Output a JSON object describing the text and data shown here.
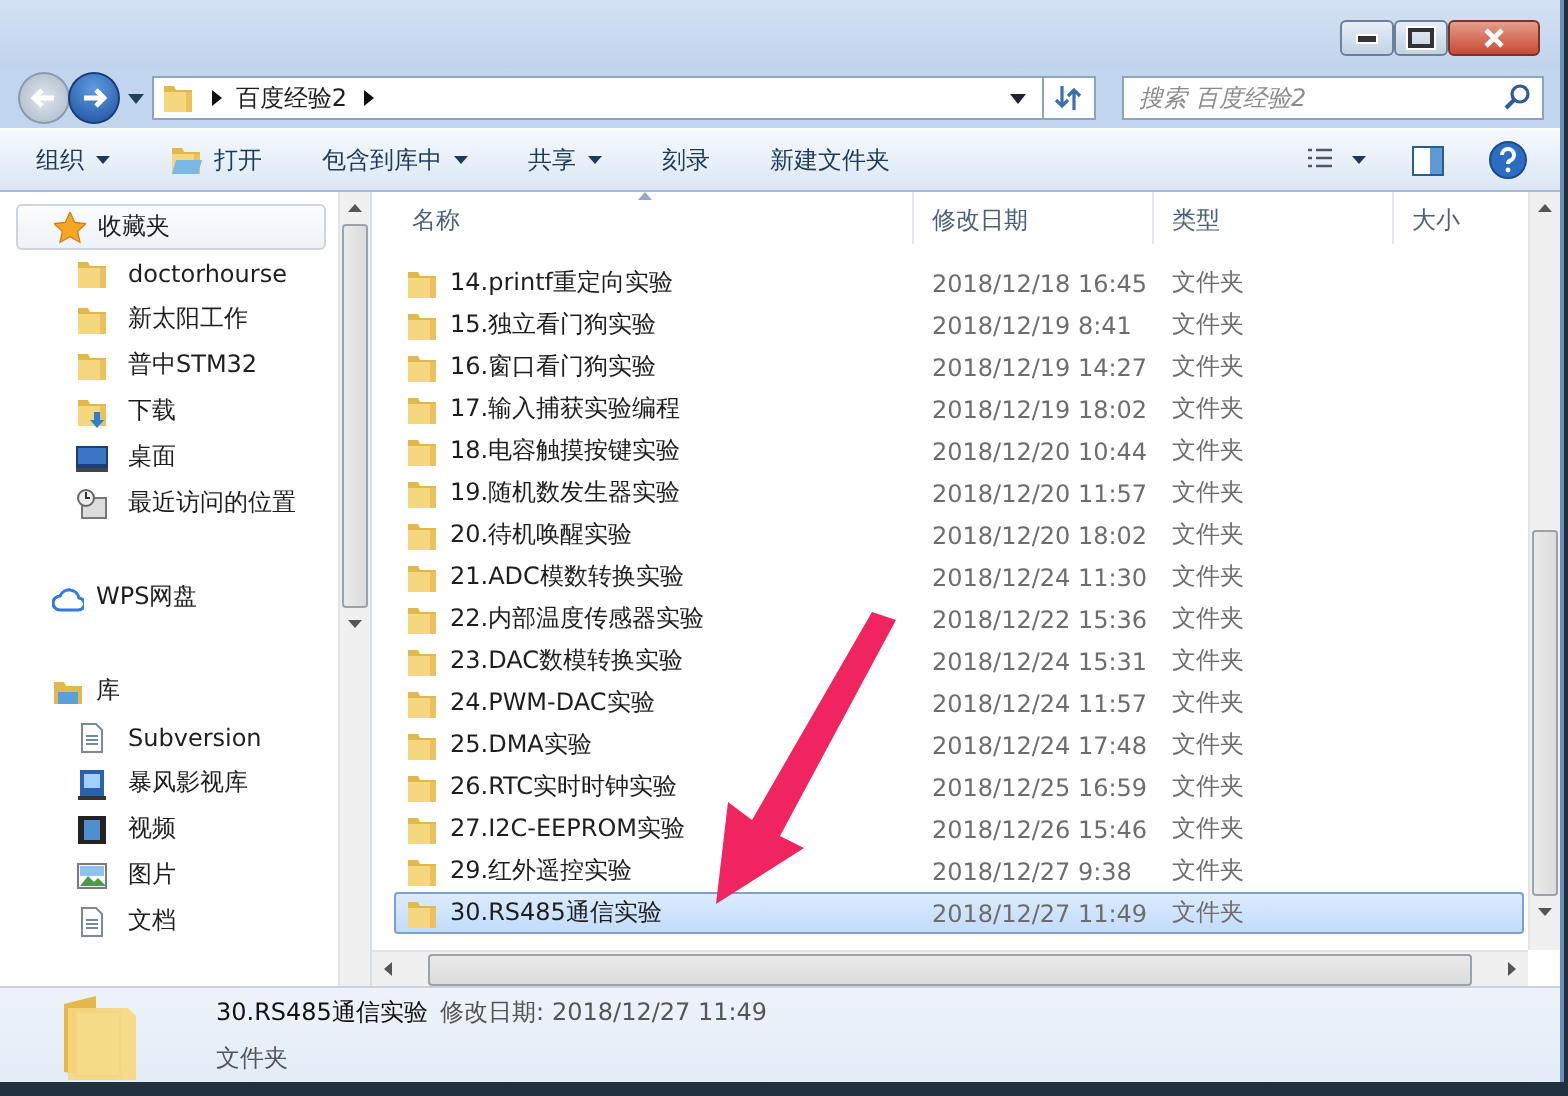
{
  "address": {
    "segments": [
      "百度经验2"
    ]
  },
  "search": {
    "placeholder": "搜索 百度经验2"
  },
  "toolbar": [
    {
      "label": "组织",
      "kind": "menu"
    },
    {
      "label": "打开",
      "kind": "open"
    },
    {
      "label": "包含到库中",
      "kind": "menu"
    },
    {
      "label": "共享",
      "kind": "menu"
    },
    {
      "label": "刻录",
      "kind": "plain"
    },
    {
      "label": "新建文件夹",
      "kind": "plain"
    }
  ],
  "sidebar": {
    "items": [
      {
        "label": "收藏夹",
        "kind": "star",
        "selected": true,
        "children": [
          {
            "label": "doctorhourse",
            "kind": "folder",
            "selected": false
          },
          {
            "label": "新太阳工作",
            "kind": "folder",
            "selected": false
          },
          {
            "label": "普中STM32",
            "kind": "folder",
            "selected": false
          },
          {
            "label": "下载",
            "kind": "download",
            "selected": false
          },
          {
            "label": "桌面",
            "kind": "desktop",
            "selected": false
          },
          {
            "label": "最近访问的位置",
            "kind": "recent",
            "selected": false
          }
        ]
      },
      {
        "label": "WPS网盘",
        "kind": "cloud",
        "selected": false
      },
      {
        "label": "库",
        "kind": "library",
        "selected": false,
        "children": [
          {
            "label": "Subversion",
            "kind": "doc",
            "selected": false
          },
          {
            "label": "暴风影视库",
            "kind": "video",
            "selected": false
          },
          {
            "label": "视频",
            "kind": "film",
            "selected": false
          },
          {
            "label": "图片",
            "kind": "picture",
            "selected": false
          },
          {
            "label": "文档",
            "kind": "doc",
            "selected": false
          }
        ]
      }
    ]
  },
  "table": {
    "columns": [
      {
        "label": "名称",
        "sorted": true
      },
      {
        "label": "修改日期",
        "sorted": false
      },
      {
        "label": "类型",
        "sorted": false
      },
      {
        "label": "大小",
        "sorted": false
      }
    ],
    "rows": [
      {
        "name": "14.printf重定向实验",
        "date": "2018/12/18 16:45",
        "type": "文件夹",
        "selected": false
      },
      {
        "name": "15.独立看门狗实验",
        "date": "2018/12/19 8:41",
        "type": "文件夹",
        "selected": false
      },
      {
        "name": "16.窗口看门狗实验",
        "date": "2018/12/19 14:27",
        "type": "文件夹",
        "selected": false
      },
      {
        "name": "17.输入捕获实验编程",
        "date": "2018/12/19 18:02",
        "type": "文件夹",
        "selected": false
      },
      {
        "name": "18.电容触摸按键实验",
        "date": "2018/12/20 10:44",
        "type": "文件夹",
        "selected": false
      },
      {
        "name": "19.随机数发生器实验",
        "date": "2018/12/20 11:57",
        "type": "文件夹",
        "selected": false
      },
      {
        "name": "20.待机唤醒实验",
        "date": "2018/12/20 18:02",
        "type": "文件夹",
        "selected": false
      },
      {
        "name": "21.ADC模数转换实验",
        "date": "2018/12/24 11:30",
        "type": "文件夹",
        "selected": false
      },
      {
        "name": "22.内部温度传感器实验",
        "date": "2018/12/22 15:36",
        "type": "文件夹",
        "selected": false
      },
      {
        "name": "23.DAC数模转换实验",
        "date": "2018/12/24 15:31",
        "type": "文件夹",
        "selected": false
      },
      {
        "name": "24.PWM-DAC实验",
        "date": "2018/12/24 11:57",
        "type": "文件夹",
        "selected": false
      },
      {
        "name": "25.DMA实验",
        "date": "2018/12/24 17:48",
        "type": "文件夹",
        "selected": false
      },
      {
        "name": "26.RTC实时时钟实验",
        "date": "2018/12/25 16:59",
        "type": "文件夹",
        "selected": false
      },
      {
        "name": "27.I2C-EEPROM实验",
        "date": "2018/12/26 15:46",
        "type": "文件夹",
        "selected": false
      },
      {
        "name": "29.红外遥控实验",
        "date": "2018/12/27 9:38",
        "type": "文件夹",
        "selected": false
      },
      {
        "name": "30.RS485通信实验",
        "date": "2018/12/27 11:49",
        "type": "文件夹",
        "selected": true
      }
    ]
  },
  "details": {
    "name": "30.RS485通信实验",
    "date_label": "修改日期:",
    "date": "2018/12/27 11:49",
    "type": "文件夹"
  }
}
